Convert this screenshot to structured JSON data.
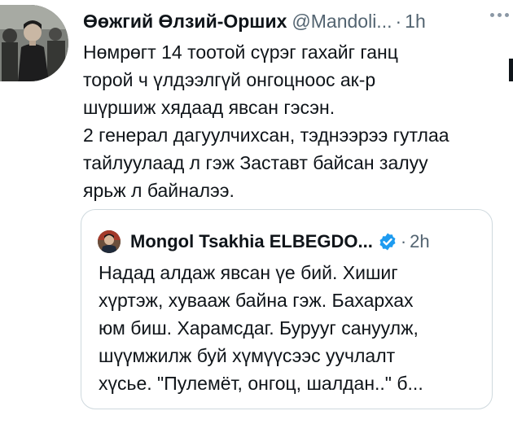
{
  "tweet": {
    "author_name": "Өөжгий Өлзий-Орших",
    "handle": "@Mandoli...",
    "separator": "·",
    "time": "1h",
    "body_lines": [
      "Нөмрөгт 14 тоотой сүрэг гахайг ганц",
      "торой ч үлдээлгүй онгоцноос ак-р",
      "шүршиж хядаад явсан гэсэн.",
      "2 генерал дагуулчихсан, тэднээрээ гутлаа",
      "тайлуулаад л гэж Заставт байсан залуу",
      "ярьж л байналээ."
    ]
  },
  "quoted_tweet": {
    "author_name": "Mongol Tsakhia ELBEGDO...",
    "separator": "·",
    "time": "2h",
    "verified_color": "#1d9bf0",
    "body_lines": [
      "Надад алдаж явсан үе бий. Хишиг",
      "хүртэж, хувааж байна гэж. Бахархах",
      "юм биш. Харамсдаг. Бурууг сануулж,",
      "шүүмжилж буй хүмүүсээс уучлалт",
      "хүсье. \"Пулемёт, онгоц, шалдан..\" б..."
    ]
  },
  "icons": {
    "more": "more-dots-icon",
    "verified": "verified-badge-icon"
  }
}
